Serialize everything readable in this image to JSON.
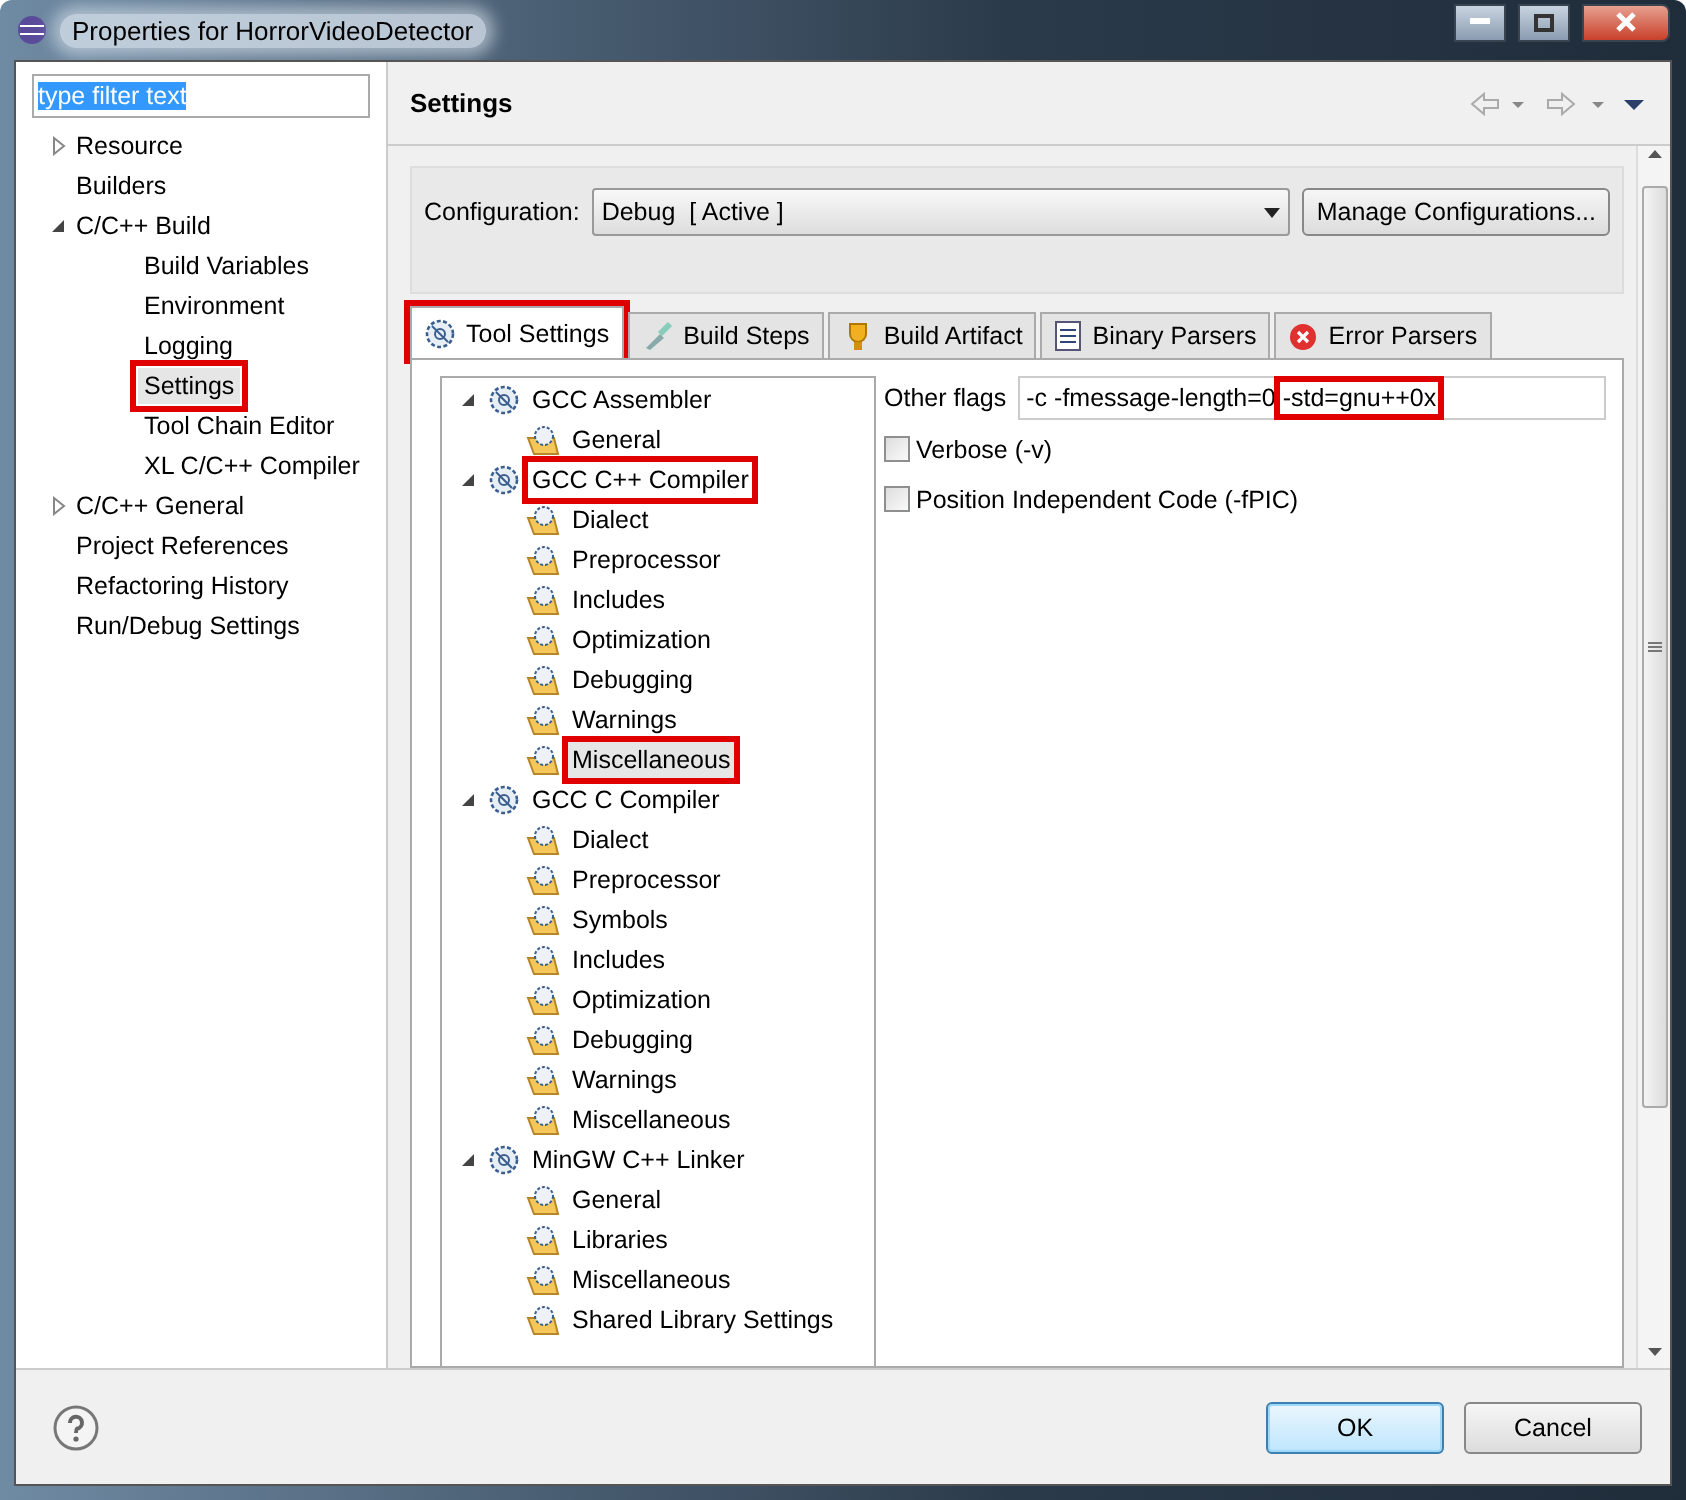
{
  "window": {
    "title": "Properties for HorrorVideoDetector"
  },
  "filter": {
    "value": "type filter text",
    "selected": true
  },
  "nav": [
    {
      "label": "Resource",
      "expanded": false,
      "selected": false,
      "highlighted": false
    },
    {
      "label": "Builders",
      "selected": false,
      "highlighted": false
    },
    {
      "label": "C/C++ Build",
      "expanded": true,
      "selected": false,
      "highlighted": false,
      "children": [
        {
          "label": "Build Variables",
          "selected": false,
          "highlighted": false
        },
        {
          "label": "Environment",
          "selected": false,
          "highlighted": false
        },
        {
          "label": "Logging",
          "selected": false,
          "highlighted": false
        },
        {
          "label": "Settings",
          "selected": true,
          "highlighted": true
        },
        {
          "label": "Tool Chain Editor",
          "selected": false,
          "highlighted": false
        },
        {
          "label": "XL C/C++ Compiler",
          "selected": false,
          "highlighted": false
        }
      ]
    },
    {
      "label": "C/C++ General",
      "expanded": false,
      "selected": false,
      "highlighted": false
    },
    {
      "label": "Project References",
      "selected": false,
      "highlighted": false
    },
    {
      "label": "Refactoring History",
      "selected": false,
      "highlighted": false
    },
    {
      "label": "Run/Debug Settings",
      "selected": false,
      "highlighted": false
    }
  ],
  "page": {
    "title": "Settings"
  },
  "configuration": {
    "label": "Configuration:",
    "value": "Debug  [ Active ]",
    "button": "Manage Configurations..."
  },
  "tabs": [
    {
      "label": "Tool Settings",
      "kind": "tool",
      "selected": true,
      "highlighted": true
    },
    {
      "label": "Build Steps",
      "kind": "steps",
      "selected": false,
      "highlighted": false
    },
    {
      "label": "Build Artifact",
      "kind": "artifact",
      "selected": false,
      "highlighted": false
    },
    {
      "label": "Binary Parsers",
      "kind": "binary",
      "selected": false,
      "highlighted": false
    },
    {
      "label": "Error Parsers",
      "kind": "error",
      "selected": false,
      "highlighted": false
    }
  ],
  "tool_tree": [
    {
      "label": "GCC Assembler",
      "expanded": true,
      "highlighted": false,
      "children": [
        {
          "label": "General",
          "selected": false,
          "highlighted": false
        }
      ]
    },
    {
      "label": "GCC C++ Compiler",
      "expanded": true,
      "highlighted": true,
      "children": [
        {
          "label": "Dialect",
          "selected": false,
          "highlighted": false
        },
        {
          "label": "Preprocessor",
          "selected": false,
          "highlighted": false
        },
        {
          "label": "Includes",
          "selected": false,
          "highlighted": false
        },
        {
          "label": "Optimization",
          "selected": false,
          "highlighted": false
        },
        {
          "label": "Debugging",
          "selected": false,
          "highlighted": false
        },
        {
          "label": "Warnings",
          "selected": false,
          "highlighted": false
        },
        {
          "label": "Miscellaneous",
          "selected": true,
          "highlighted": true
        }
      ]
    },
    {
      "label": "GCC C Compiler",
      "expanded": true,
      "highlighted": false,
      "children": [
        {
          "label": "Dialect",
          "selected": false,
          "highlighted": false
        },
        {
          "label": "Preprocessor",
          "selected": false,
          "highlighted": false
        },
        {
          "label": "Symbols",
          "selected": false,
          "highlighted": false
        },
        {
          "label": "Includes",
          "selected": false,
          "highlighted": false
        },
        {
          "label": "Optimization",
          "selected": false,
          "highlighted": false
        },
        {
          "label": "Debugging",
          "selected": false,
          "highlighted": false
        },
        {
          "label": "Warnings",
          "selected": false,
          "highlighted": false
        },
        {
          "label": "Miscellaneous",
          "selected": false,
          "highlighted": false
        }
      ]
    },
    {
      "label": "MinGW C++ Linker",
      "expanded": true,
      "highlighted": false,
      "children": [
        {
          "label": "General",
          "selected": false,
          "highlighted": false
        },
        {
          "label": "Libraries",
          "selected": false,
          "highlighted": false
        },
        {
          "label": "Miscellaneous",
          "selected": false,
          "highlighted": false
        },
        {
          "label": "Shared Library Settings",
          "selected": false,
          "highlighted": false
        }
      ]
    }
  ],
  "other_flags": {
    "label": "Other flags",
    "value_parts": [
      {
        "text": "-c -fmessage-length=0 ",
        "highlighted": false
      },
      {
        "text": "-std=gnu++0x",
        "highlighted": true
      }
    ]
  },
  "checkboxes": [
    {
      "label": "Verbose (-v)",
      "checked": false
    },
    {
      "label": "Position Independent Code (-fPIC)",
      "checked": false
    }
  ],
  "buttons": [
    {
      "label": "OK",
      "default": true
    },
    {
      "label": "Cancel",
      "default": false
    }
  ]
}
